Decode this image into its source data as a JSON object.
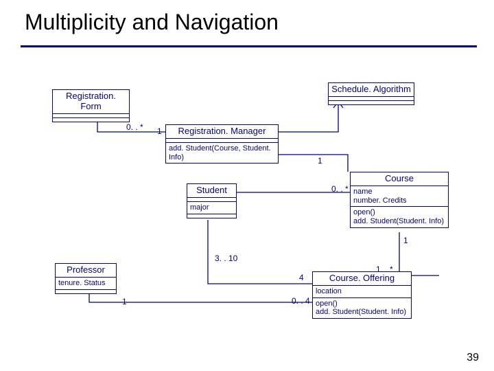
{
  "title": "Multiplicity and Navigation",
  "page_number": "39",
  "classes": {
    "regform": {
      "name": "Registration. Form"
    },
    "schedalg": {
      "name": "Schedule. Algorithm"
    },
    "regmgr": {
      "name": "Registration. Manager",
      "op1": "add. Student(Course, Student. Info)"
    },
    "student": {
      "name": "Student",
      "attr1": "major"
    },
    "course": {
      "name": "Course",
      "attr1": "name",
      "attr2": "number. Credits",
      "op1": "open()",
      "op2": "add. Student(Student. Info)"
    },
    "professor": {
      "name": "Professor",
      "attr1": "tenure. Status"
    },
    "offering": {
      "name": "Course. Offering",
      "attr1": "location",
      "op1": "open()",
      "op2": "add. Student(Student. Info)"
    }
  },
  "mult": {
    "regform_regmgr_a": "0. . *",
    "regform_regmgr_b": "1",
    "regmgr_course": "1",
    "student_course": "0. . *",
    "course_offering": "1",
    "student_offering_a": "3. . 10",
    "student_offering_b": "4",
    "professor_offering_a": "1",
    "professor_offering_b": "0. . 4",
    "offering_other": "1. . *"
  }
}
